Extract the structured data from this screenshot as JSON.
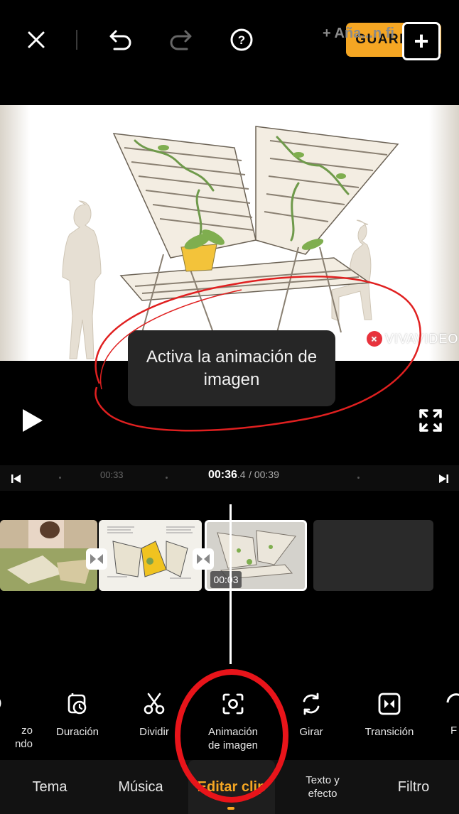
{
  "topbar": {
    "close_icon": "close-icon",
    "undo_icon": "undo-icon",
    "redo_icon": "redo-icon",
    "help_icon": "help-icon",
    "save_label": "GUARDAR",
    "accent": "#f5a623"
  },
  "preview": {
    "watermark": "VIVAVIDEO",
    "watermark_close": "×",
    "tooltip": "Activa la animación de imagen"
  },
  "player": {
    "play_icon": "play-icon",
    "fullscreen_icon": "fullscreen-icon"
  },
  "timeline": {
    "mark_time": "00:33",
    "current_time": "00:36",
    "current_sub": ".4",
    "total": "/ 00:39",
    "clip_duration": "00:03",
    "add_clip_label": "+ Aña...n fi",
    "add_icon": "+"
  },
  "tools": [
    {
      "label": "zo\nndo",
      "icon": "partial-icon"
    },
    {
      "label": "Duración",
      "icon": "duration-icon"
    },
    {
      "label": "Dividir",
      "icon": "scissors-icon"
    },
    {
      "label": "Animación\nde imagen",
      "icon": "image-animation-icon"
    },
    {
      "label": "Girar",
      "icon": "rotate-icon"
    },
    {
      "label": "Transición",
      "icon": "transition-icon"
    },
    {
      "label": "F",
      "icon": "partial-icon"
    }
  ],
  "tabs": [
    {
      "label": "Tema"
    },
    {
      "label": "Música"
    },
    {
      "label": "Editar clip",
      "active": true
    },
    {
      "label": "Texto y\nefecto"
    },
    {
      "label": "Filtro"
    }
  ],
  "annotation_color": "#e02020"
}
